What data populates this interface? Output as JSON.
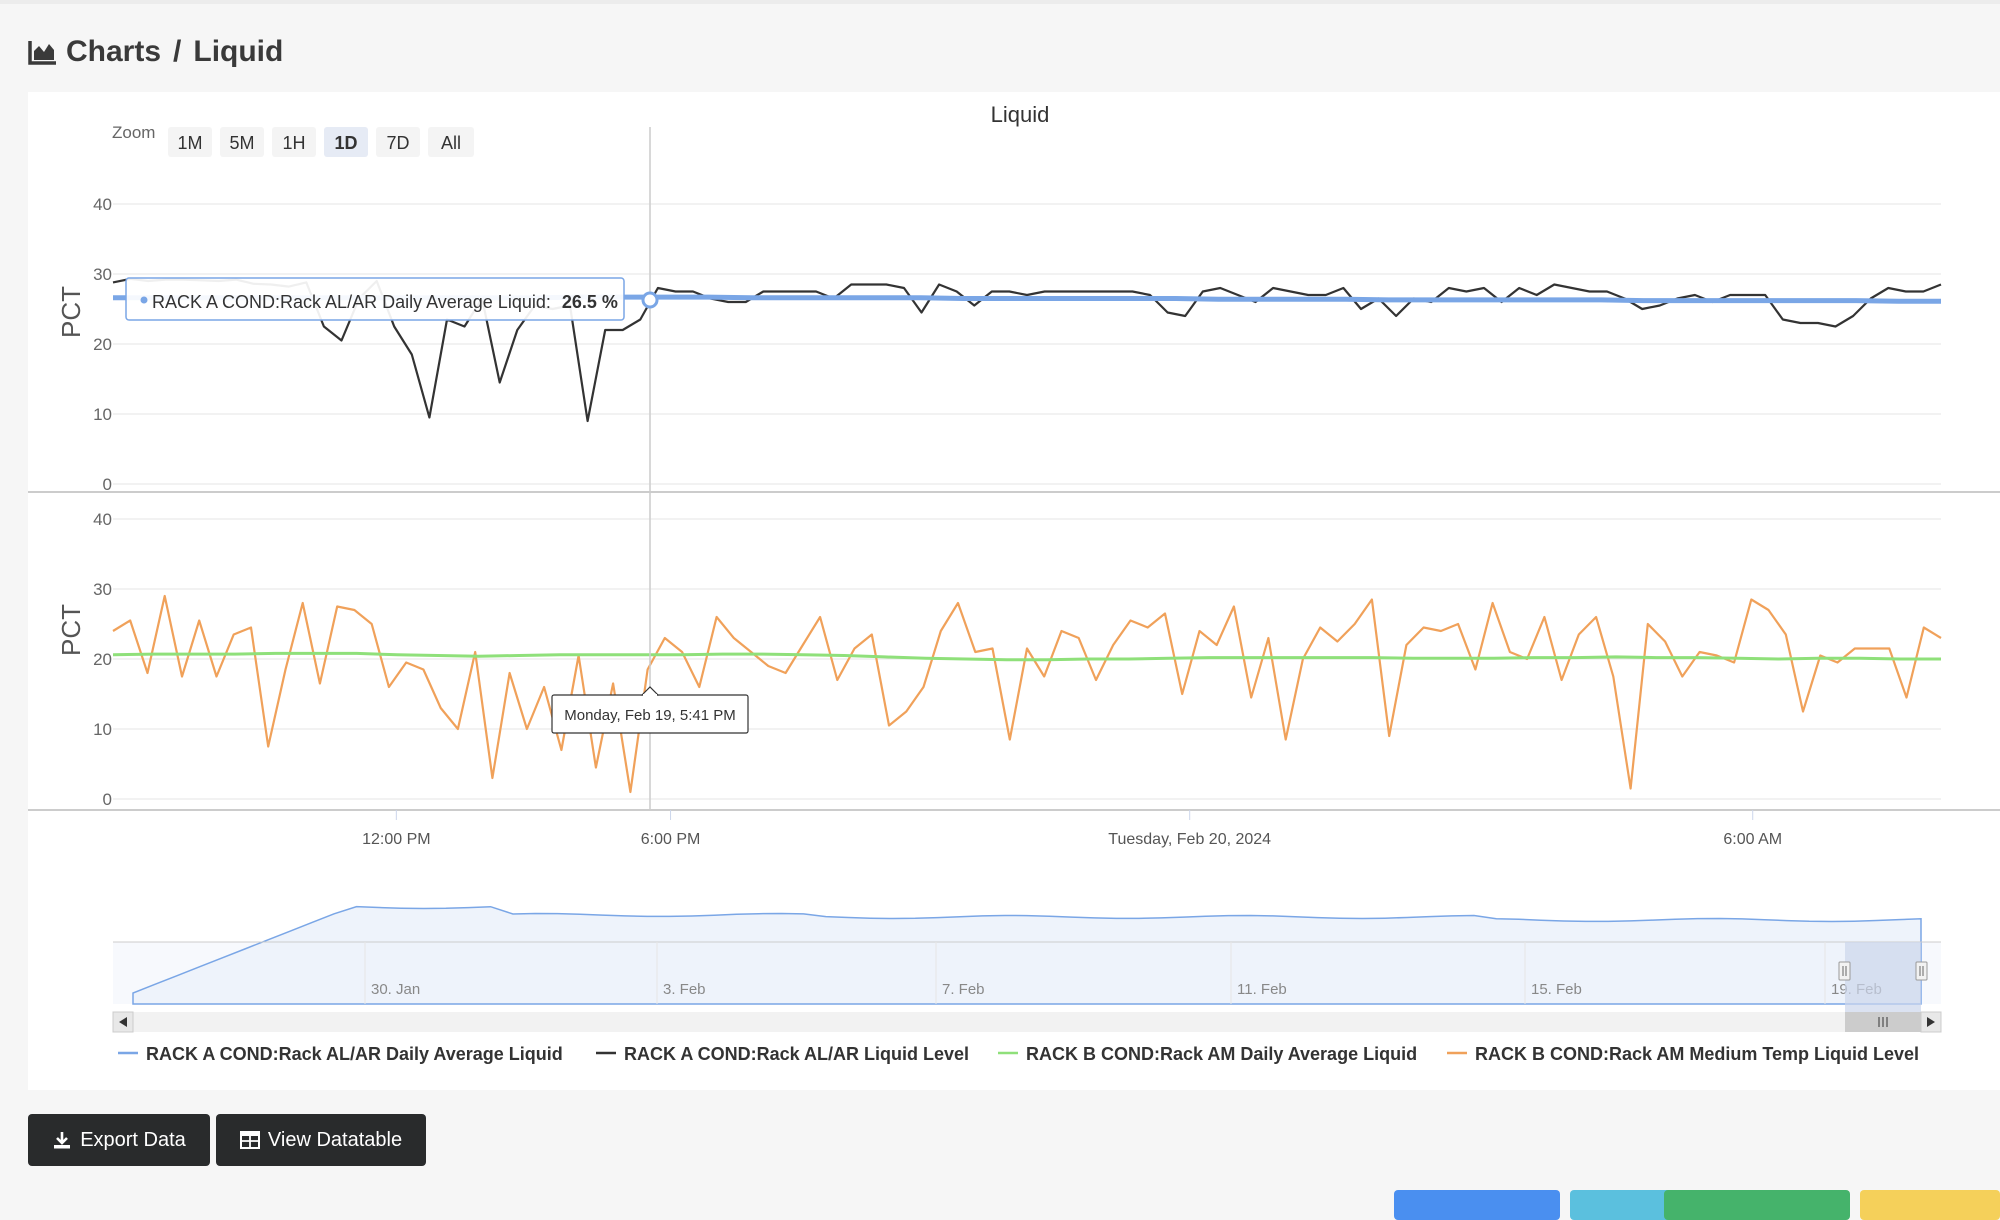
{
  "breadcrumb": {
    "root": "Charts",
    "separator": "/",
    "current": "Liquid"
  },
  "buttons": {
    "export": "Export Data",
    "datatable": "View Datatable"
  },
  "bottom_buttons": [
    {
      "name": "add-button",
      "color": "#4a8ff0"
    },
    {
      "name": "back-button",
      "color": "#5bc0de"
    },
    {
      "name": "save-button",
      "color": "#45b36b"
    },
    {
      "name": "warning-button",
      "color": "#f5d05a"
    }
  ],
  "tooltip": {
    "series": "RACK A COND:Rack AL/AR Daily Average Liquid:",
    "value": "26.5 %",
    "date": "Monday, Feb 19, 5:41 PM"
  },
  "chart_data": {
    "type": "line",
    "title": "Liquid",
    "zoom": {
      "label": "Zoom",
      "options": [
        "1M",
        "5M",
        "1H",
        "1D",
        "7D",
        "All"
      ],
      "selected": "1D"
    },
    "panes": [
      {
        "ylabel": "PCT",
        "ylim": [
          0,
          40
        ],
        "yticks": [
          0,
          10,
          20,
          30,
          40
        ],
        "series": [
          "RACK A COND:Rack AL/AR Daily Average Liquid",
          "RACK A COND:Rack AL/AR Liquid Level"
        ]
      },
      {
        "ylabel": "PCT",
        "ylim": [
          0,
          40
        ],
        "yticks": [
          0,
          10,
          20,
          30,
          40
        ],
        "series": [
          "RACK B COND:Rack AM Daily Average Liquid",
          "RACK B COND:Rack AM Medium Temp Liquid Level"
        ]
      }
    ],
    "x_ticks": [
      "12:00 PM",
      "6:00 PM",
      "Tuesday, Feb 20, 2024",
      "6:00 AM"
    ],
    "navigator_ticks": [
      "30. Jan",
      "3. Feb",
      "7. Feb",
      "11. Feb",
      "15. Feb",
      "19. Feb"
    ],
    "series": [
      {
        "name": "RACK A COND:Rack AL/AR Daily Average Liquid",
        "color": "#7aa6e6",
        "pane": 0,
        "values": [
          26.6,
          26.6,
          26.6,
          26.6,
          26.6,
          26.6,
          26.6,
          26.6,
          26.6,
          26.6,
          26.6,
          26.7,
          26.7,
          26.7,
          26.7,
          26.6,
          26.6,
          26.6,
          26.6,
          26.6,
          26.5,
          26.5,
          26.5,
          26.5,
          26.5,
          26.5,
          26.4,
          26.4,
          26.4,
          26.4,
          26.3,
          26.3,
          26.3,
          26.3,
          26.3,
          26.3,
          26.2,
          26.2,
          26.2,
          26.2,
          26.2,
          26.2,
          26.1,
          26.1
        ]
      },
      {
        "name": "RACK A COND:Rack AL/AR Liquid Level",
        "color": "#333333",
        "pane": 0,
        "values": [
          28.8,
          29.3,
          29.0,
          29.2,
          29.2,
          29.1,
          29.0,
          29.2,
          28.6,
          28.5,
          28.2,
          28.8,
          22.5,
          20.5,
          26.5,
          29.0,
          22.5,
          18.5,
          9.5,
          23.5,
          22.5,
          26.5,
          14.5,
          22.0,
          25.5,
          25.0,
          25.5,
          9.0,
          22.0,
          22.0,
          23.5,
          28.0,
          27.5,
          27.5,
          26.5,
          26.0,
          26.0,
          27.5,
          27.5,
          27.5,
          27.5,
          26.5,
          28.5,
          28.5,
          28.5,
          28.0,
          24.5,
          28.5,
          27.5,
          25.5,
          27.5,
          27.5,
          27.0,
          27.5,
          27.5,
          27.5,
          27.5,
          27.5,
          27.5,
          27.0,
          24.5,
          24.0,
          27.5,
          28.0,
          27.0,
          26.0,
          28.0,
          27.5,
          27.0,
          27.0,
          28.0,
          25.0,
          26.5,
          24.0,
          26.5,
          26.0,
          28.0,
          27.5,
          28.0,
          26.0,
          28.0,
          27.0,
          28.5,
          28.0,
          27.5,
          27.5,
          26.5,
          25.0,
          25.5,
          26.5,
          27.0,
          26.0,
          27.0,
          27.0,
          27.0,
          23.5,
          23.0,
          23.0,
          22.5,
          24.0,
          26.5,
          28.0,
          27.5,
          27.5,
          28.5
        ]
      },
      {
        "name": "RACK B COND:Rack AM Daily Average Liquid",
        "color": "#8fe07a",
        "pane": 1,
        "values": [
          20.6,
          20.7,
          20.7,
          20.7,
          20.8,
          20.8,
          20.8,
          20.6,
          20.5,
          20.4,
          20.5,
          20.6,
          20.6,
          20.6,
          20.6,
          20.7,
          20.7,
          20.6,
          20.5,
          20.3,
          20.1,
          20.0,
          19.9,
          19.9,
          20.0,
          20.0,
          20.1,
          20.2,
          20.2,
          20.2,
          20.2,
          20.2,
          20.1,
          20.1,
          20.1,
          20.2,
          20.2,
          20.3,
          20.2,
          20.2,
          20.1,
          20.0,
          20.1,
          20.1,
          20.0,
          20.0
        ]
      },
      {
        "name": "RACK B COND:Rack AM Medium Temp Liquid Level",
        "color": "#f0a15a",
        "pane": 1,
        "values": [
          24.0,
          25.5,
          18.0,
          29.0,
          17.5,
          25.5,
          17.5,
          23.5,
          24.5,
          7.5,
          18.5,
          28.0,
          16.5,
          27.5,
          27.0,
          25.0,
          16.0,
          19.5,
          18.5,
          13.0,
          10.0,
          21.0,
          3.0,
          18.0,
          10.0,
          16.0,
          7.0,
          20.5,
          4.5,
          16.5,
          1.0,
          18.5,
          23.0,
          21.0,
          16.0,
          26.0,
          23.0,
          21.0,
          19.0,
          18.0,
          22.0,
          26.0,
          17.0,
          21.5,
          23.5,
          10.5,
          12.5,
          16.0,
          24.0,
          28.0,
          21.0,
          21.5,
          8.5,
          21.5,
          17.5,
          24.0,
          23.0,
          17.0,
          22.0,
          25.5,
          24.5,
          26.5,
          15.0,
          24.0,
          22.0,
          27.5,
          14.5,
          23.0,
          8.5,
          20.0,
          24.5,
          22.5,
          25.0,
          28.5,
          9.0,
          22.0,
          24.5,
          24.0,
          25.0,
          18.5,
          28.0,
          21.0,
          20.0,
          26.0,
          17.0,
          23.5,
          26.0,
          17.5,
          1.5,
          25.0,
          22.5,
          17.5,
          21.0,
          20.5,
          19.5,
          28.5,
          27.0,
          23.5,
          12.5,
          20.5,
          19.5,
          21.5,
          21.5,
          21.5,
          14.5,
          24.5,
          23.0
        ]
      }
    ],
    "legend_position": "bottom"
  }
}
